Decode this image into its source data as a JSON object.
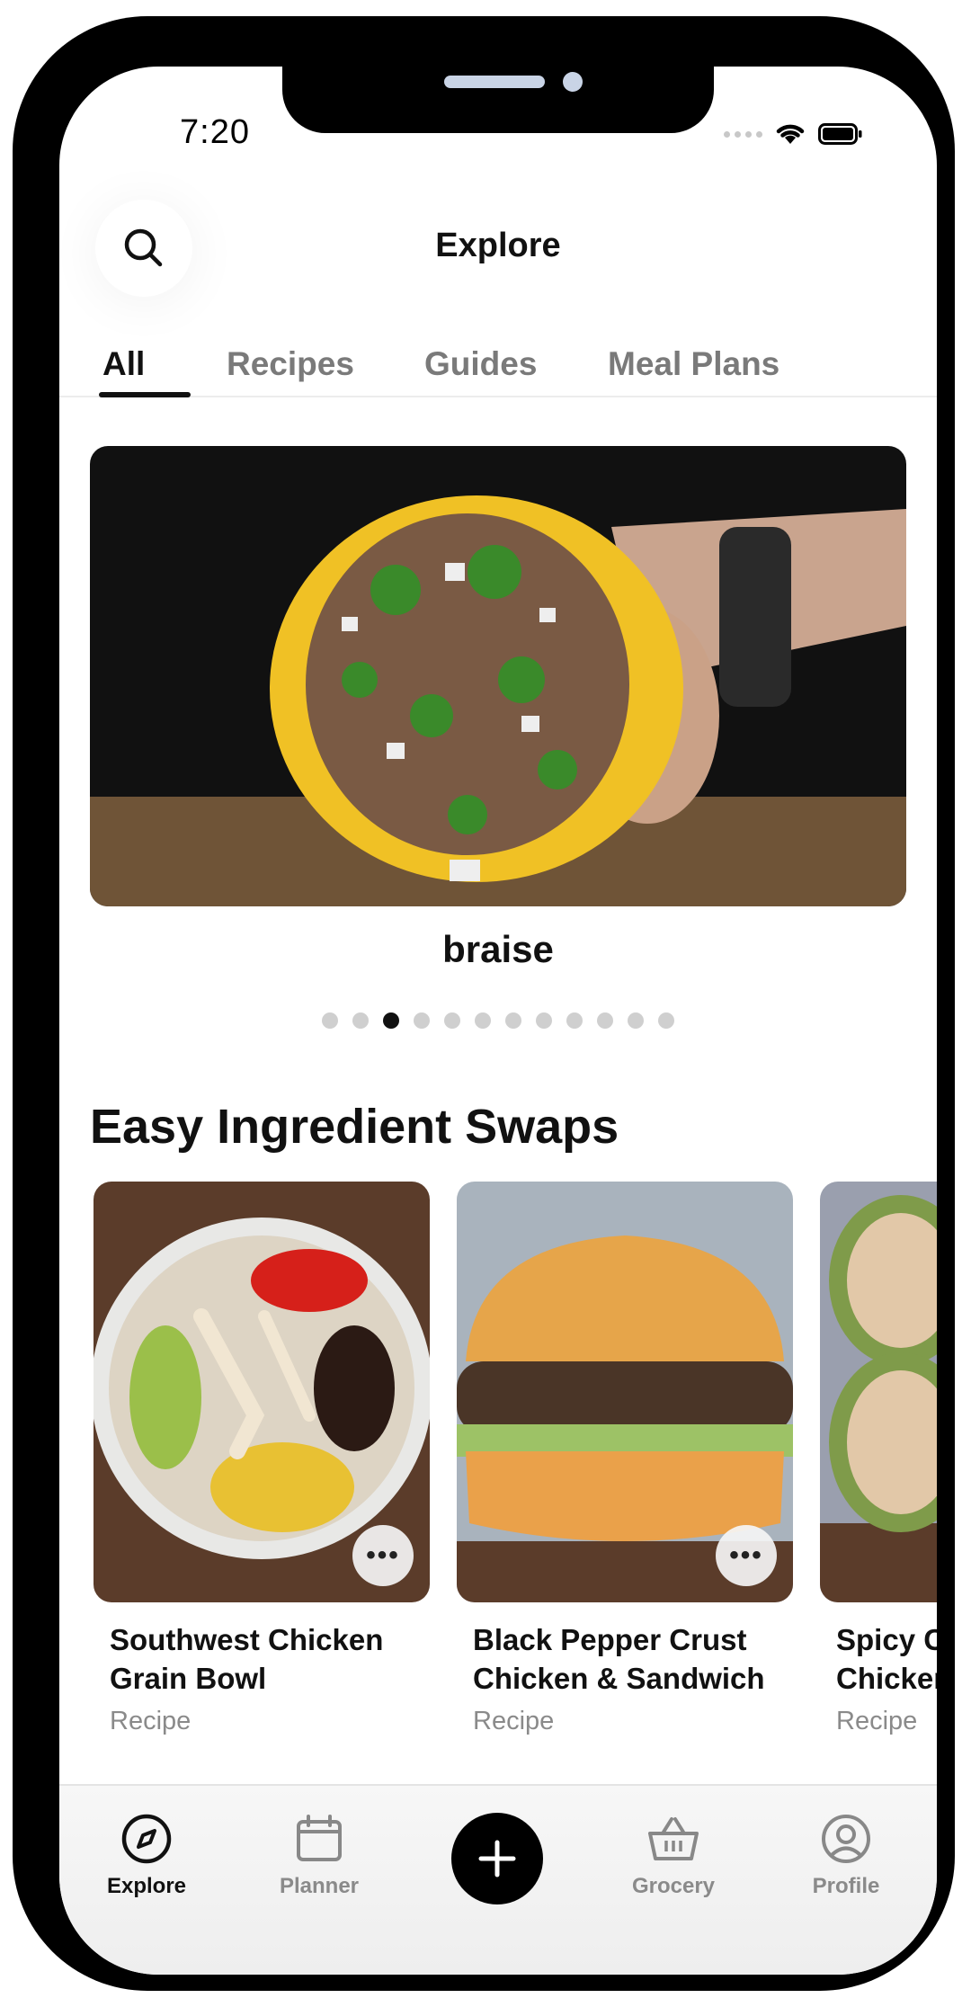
{
  "status_bar": {
    "time": "7:20"
  },
  "header": {
    "title": "Explore"
  },
  "tabs": [
    {
      "label": "All",
      "active": true
    },
    {
      "label": "Recipes",
      "active": false
    },
    {
      "label": "Guides",
      "active": false
    },
    {
      "label": "Meal Plans",
      "active": false
    }
  ],
  "carousel": {
    "title": "braise",
    "page_count": 12,
    "active_page": 3
  },
  "section": {
    "title": "Easy Ingredient Swaps",
    "cards": [
      {
        "title": "Southwest Chicken\nGrain Bowl",
        "type": "Recipe"
      },
      {
        "title": "Black Pepper Crust\nChicken & Sandwich",
        "type": "Recipe"
      },
      {
        "title": "Spicy Chicken\nChicken Wrap",
        "type": "Recipe"
      }
    ]
  },
  "bottom_nav": {
    "items": [
      {
        "label": "Explore",
        "icon": "compass-icon",
        "active": true
      },
      {
        "label": "Planner",
        "icon": "calendar-icon",
        "active": false
      },
      {
        "label": "Grocery",
        "icon": "basket-icon",
        "active": false
      },
      {
        "label": "Profile",
        "icon": "user-circle-icon",
        "active": false
      }
    ],
    "add_icon": "plus-icon"
  },
  "colors": {
    "accent": "#111111",
    "inactive": "#7a7a7a",
    "background": "#ffffff"
  }
}
